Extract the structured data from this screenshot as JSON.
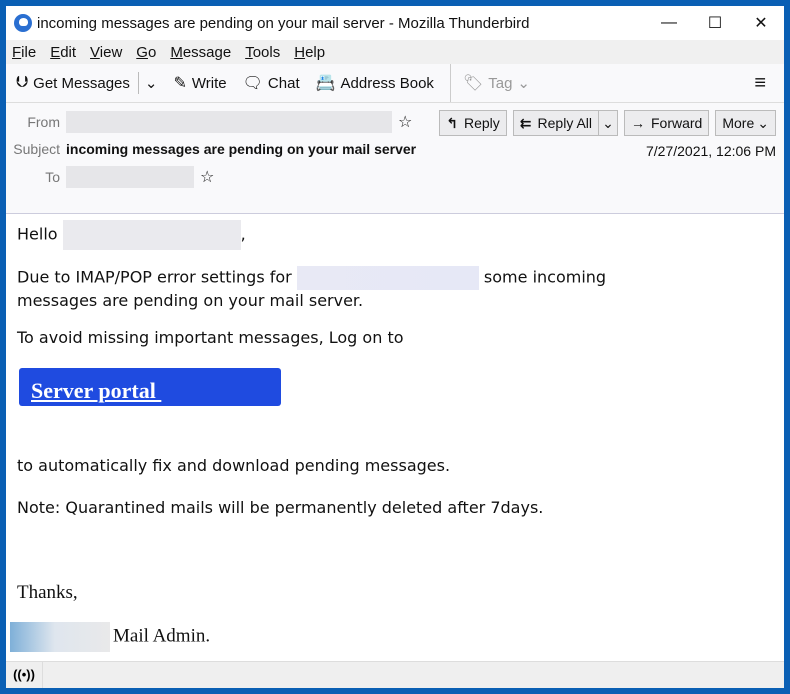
{
  "window": {
    "title": "incoming messages are pending on your mail server - Mozilla Thunderbird",
    "controls": {
      "minimize": "—",
      "maximize": "☐",
      "close": "✕"
    }
  },
  "menubar": {
    "items": [
      {
        "accel": "F",
        "rest": "ile"
      },
      {
        "accel": "E",
        "rest": "dit"
      },
      {
        "accel": "V",
        "rest": "iew"
      },
      {
        "accel": "G",
        "rest": "o"
      },
      {
        "accel": "M",
        "rest": "essage"
      },
      {
        "accel": "T",
        "rest": "ools"
      },
      {
        "accel": "H",
        "rest": "elp"
      }
    ]
  },
  "toolbar": {
    "get_messages": "Get Messages",
    "write": "Write",
    "chat": "Chat",
    "address_book": "Address Book",
    "tag": "Tag",
    "menu_icon": "≡"
  },
  "header": {
    "from_label": "From",
    "subject_label": "Subject",
    "to_label": "To",
    "subject": "incoming messages are pending on your mail server",
    "date": "7/27/2021, 12:06 PM",
    "buttons": {
      "reply": "Reply",
      "reply_all": "Reply All",
      "forward": "Forward",
      "more": "More"
    }
  },
  "body": {
    "greeting": "Hello",
    "greeting_comma": ",",
    "line1_pre": "Due to IMAP/POP error settings for",
    "line1_post": "some incoming",
    "line2": "messages are pending on your mail server.",
    "line3": "To avoid missing important messages, Log on to",
    "portal_link": "Server portal ",
    "line4": "to automatically fix and download pending messages.",
    "note": "Note: Quarantined mails will be permanently deleted after 7days.",
    "thanks": "Thanks,",
    "signature": "Mail Admin.",
    "link_color": "#1f4be0"
  },
  "statusbar": {
    "icon": "((•))"
  }
}
